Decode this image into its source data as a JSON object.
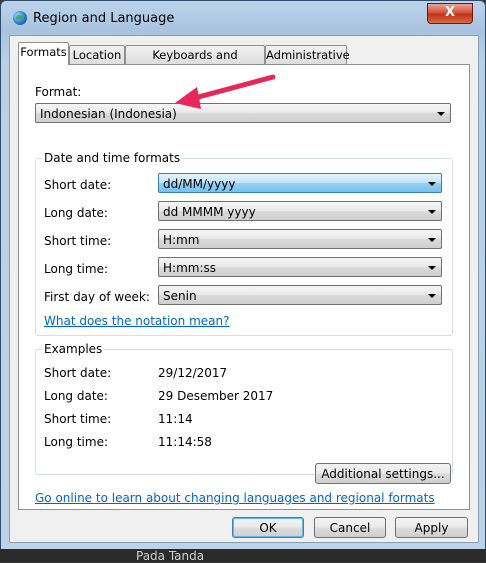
{
  "window": {
    "title": "Region and Language",
    "close_symbol": "X"
  },
  "tabs": [
    {
      "label": "Formats"
    },
    {
      "label": "Location"
    },
    {
      "label": "Keyboards and Languages"
    },
    {
      "label": "Administrative"
    }
  ],
  "format": {
    "label": "Format:",
    "value": "Indonesian (Indonesia)"
  },
  "date_time_formats": {
    "legend": "Date and time formats",
    "rows": [
      {
        "label": "Short date:",
        "value": "dd/MM/yyyy"
      },
      {
        "label": "Long date:",
        "value": "dd MMMM yyyy"
      },
      {
        "label": "Short time:",
        "value": "H:mm"
      },
      {
        "label": "Long time:",
        "value": "H:mm:ss"
      },
      {
        "label": "First day of week:",
        "value": "Senin"
      }
    ],
    "notation_link": "What does the notation mean?"
  },
  "examples": {
    "legend": "Examples",
    "rows": [
      {
        "label": "Short date:",
        "value": "29/12/2017"
      },
      {
        "label": "Long date:",
        "value": "29 Desember 2017"
      },
      {
        "label": "Short time:",
        "value": "11:14"
      },
      {
        "label": "Long time:",
        "value": "11:14:58"
      }
    ]
  },
  "additional_settings_label": "Additional settings...",
  "online_link": "Go online to learn about changing languages and regional formats",
  "buttons": {
    "ok": "OK",
    "cancel": "Cancel",
    "apply": "Apply"
  },
  "background_text": "Pada Tanda",
  "colors": {
    "annotation_arrow": "#e8265a",
    "link": "#0066cc",
    "selected_combo": "#76c2ef"
  }
}
